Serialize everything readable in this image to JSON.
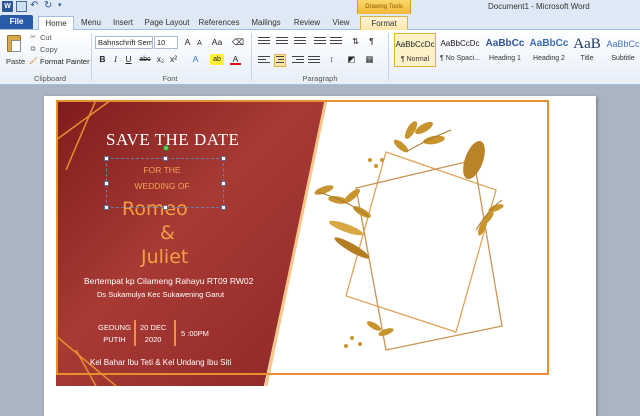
{
  "window": {
    "title": "Document1 - Microsoft Word",
    "contextual_tab_group": "Drawing Tools"
  },
  "tabs": [
    "File",
    "Home",
    "Menu",
    "Insert",
    "Page Layout",
    "References",
    "Mailings",
    "Review",
    "View",
    "Format"
  ],
  "active_tab": "Home",
  "ribbon": {
    "clipboard": {
      "paste": "Paste",
      "cut": "Cut",
      "copy": "Copy",
      "format_painter": "Format Painter",
      "label": "Clipboard"
    },
    "font": {
      "family": "Bahnschrift Sem",
      "size": "10",
      "label": "Font",
      "bold": "B",
      "italic": "I",
      "underline": "U",
      "strike": "abc",
      "sub": "x₂",
      "sup": "x²",
      "grow": "A",
      "shrink": "A",
      "clear": "Aa",
      "effects": "A",
      "highlight": "ab",
      "font_color": "A"
    },
    "paragraph": {
      "label": "Paragraph"
    },
    "styles": [
      {
        "sample": "AaBbCcDc",
        "name": "¶ Normal",
        "selected": true
      },
      {
        "sample": "AaBbCcDc",
        "name": "¶ No Spaci..."
      },
      {
        "sample": "AaBbCc",
        "name": "Heading 1"
      },
      {
        "sample": "AaBbCc",
        "name": "Heading 2"
      },
      {
        "sample": "AaB",
        "name": "Title"
      },
      {
        "sample": "AaBbCc",
        "name": "Subtitle"
      }
    ]
  },
  "card": {
    "save_the_date": "SAVE THE DATE",
    "for_the": "FOR THE",
    "wedding_of": "WEDDING OF",
    "groom": "Romeo",
    "ampersand": "&",
    "bride": "Juliet",
    "venue": "Bertempat kp Cilameng Rahayu RT09 RW02",
    "address": "Ds Sukamulya Kec Sukawening Garut",
    "place_line1": "GEDUNG",
    "place_line2": "PUTIH",
    "date_line1": "20 DEC",
    "date_line2": "2020",
    "time": "5 :00PM",
    "families": "Kel Bahar Ibu Teti & Kel Undang Ibu Siti"
  },
  "colors": {
    "accent_orange": "#e8902f",
    "card_red": "#8e2727",
    "gold": "#c8942e"
  }
}
